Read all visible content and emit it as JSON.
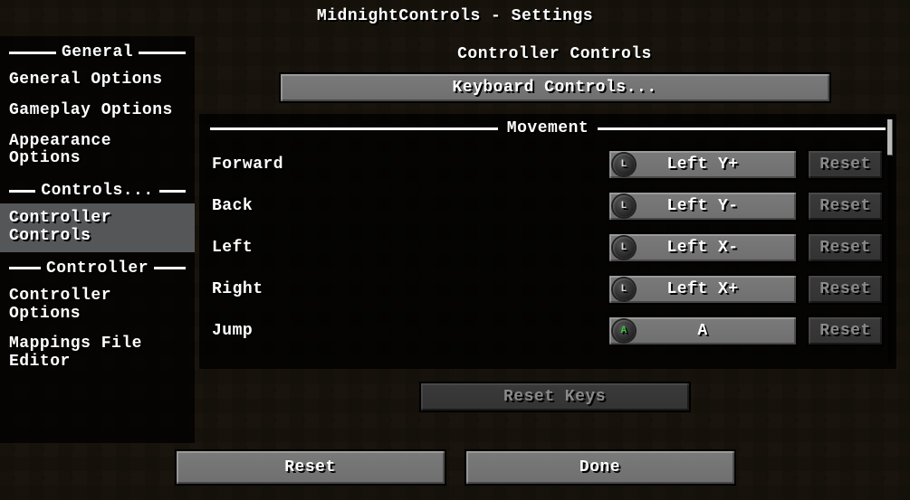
{
  "title": "MidnightControls - Settings",
  "sidebar": {
    "sections": [
      {
        "header": "General",
        "items": [
          {
            "label": "General Options",
            "active": false
          },
          {
            "label": "Gameplay Options",
            "active": false
          },
          {
            "label": "Appearance Options",
            "active": false
          }
        ]
      },
      {
        "header": "Controls...",
        "items": [
          {
            "label": "Controller Controls",
            "active": true
          }
        ]
      },
      {
        "header": "Controller",
        "items": [
          {
            "label": "Controller Options",
            "active": false
          },
          {
            "label": "Mappings File Editor",
            "active": false
          }
        ]
      }
    ]
  },
  "main": {
    "subtitle": "Controller Controls",
    "keyboard_button": "Keyboard Controls...",
    "group_header": "Movement",
    "bindings": [
      {
        "label": "Forward",
        "value": "Left Y+",
        "icon": "L",
        "reset": "Reset"
      },
      {
        "label": "Back",
        "value": "Left Y-",
        "icon": "L",
        "reset": "Reset"
      },
      {
        "label": "Left",
        "value": "Left X-",
        "icon": "L",
        "reset": "Reset"
      },
      {
        "label": "Right",
        "value": "Left X+",
        "icon": "L",
        "reset": "Reset"
      },
      {
        "label": "Jump",
        "value": "A",
        "icon": "A",
        "reset": "Reset"
      }
    ],
    "reset_keys": "Reset Keys"
  },
  "footer": {
    "reset": "Reset",
    "done": "Done"
  }
}
